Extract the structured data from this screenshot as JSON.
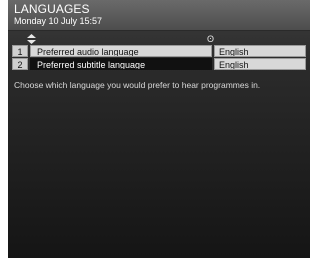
{
  "header": {
    "title": "LANGUAGES",
    "subtitle": "Monday 10 July 15:57"
  },
  "column_icons": {
    "left": "up-down-arrows-icon",
    "right": "info-icon",
    "right_glyph": "ʘ"
  },
  "settings": [
    {
      "number": "1",
      "label": "Preferred audio language",
      "value": "English",
      "selected": false
    },
    {
      "number": "2",
      "label": "Preferred subtitle language",
      "value": "English",
      "selected": true
    }
  ],
  "help_text": "Choose which language you would prefer to hear programmes in.",
  "colors": {
    "header_bg": "#5c5c5c",
    "row_bg": "#d8d8d8",
    "selected_bg": "#111111"
  }
}
